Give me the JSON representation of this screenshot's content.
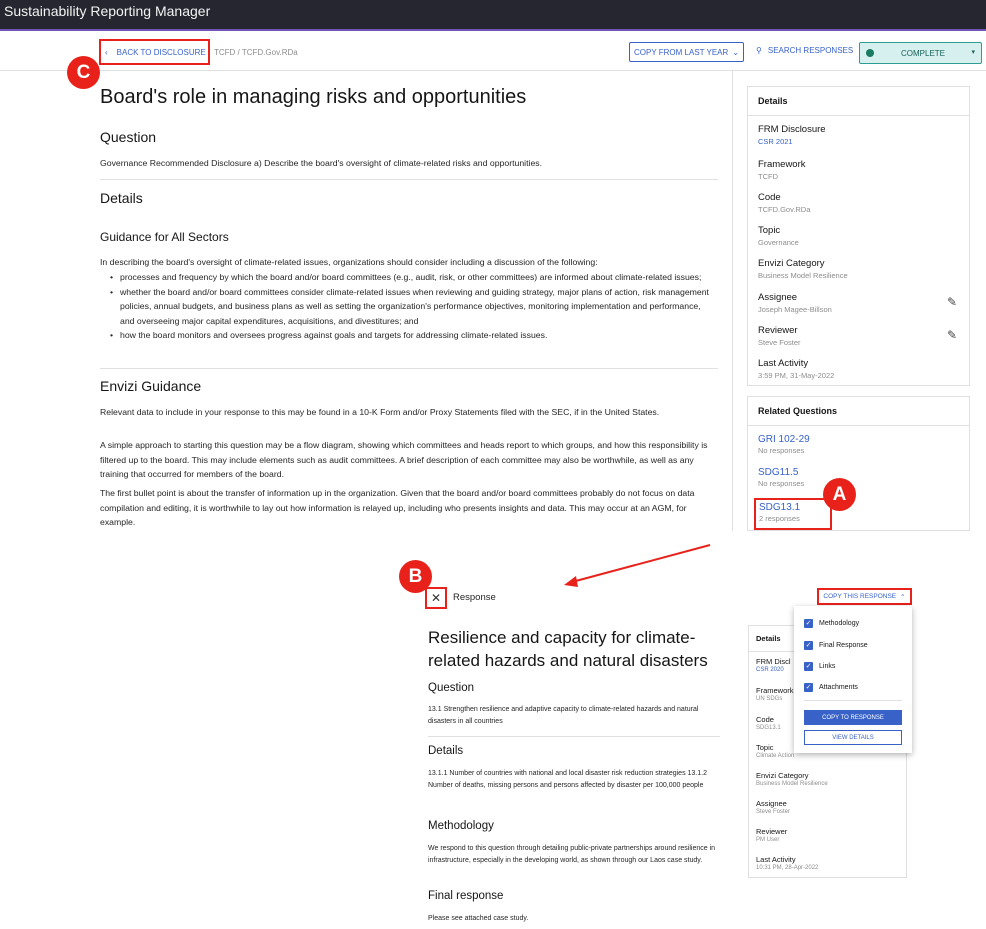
{
  "app": {
    "title": "Sustainability Reporting Manager"
  },
  "subbar": {
    "back_label": "BACK TO DISCLOSURE",
    "breadcrumb": "TCFD  /  TCFD.Gov.RDa",
    "copy_from_last_year": "COPY FROM LAST YEAR",
    "search_responses": "SEARCH RESPONSES",
    "status": "COMPLETE",
    "status_color": "#1a7a62"
  },
  "markers": {
    "a": "A",
    "b": "B",
    "c": "C"
  },
  "main": {
    "title": "Board's role in managing risks and opportunities",
    "question_heading": "Question",
    "question_text": "Governance Recommended Disclosure a) Describe the board's oversight of climate-related risks and opportunities.",
    "details_heading": "Details",
    "guidance_heading": "Guidance for All Sectors",
    "guidance_intro": "In describing the board's oversight of climate-related issues, organizations should consider including a discussion of the following:",
    "bullets": [
      "processes and frequency by which the board and/or board committees (e.g., audit, risk, or other committees) are informed about climate-related issues;",
      "whether the board and/or board committees consider climate-related issues when reviewing and guiding strategy, major plans of action, risk management policies, annual budgets, and business plans as well as setting the organization's performance objectives, monitoring implementation and performance, and overseeing major capital expenditures, acquisitions, and divestitures; and",
      "how the board monitors and oversees progress against goals and targets for addressing climate-related issues."
    ],
    "envizi_heading": "Envizi Guidance",
    "envizi_p1": "Relevant data to include in your response to this may be found in a 10-K Form and/or Proxy Statements filed with the SEC, if in the United States.",
    "envizi_p2": "A simple approach to starting this question may be a flow diagram, showing which committees and heads report to which groups, and how this responsibility is filtered up to the board. This may include elements such as audit committees. A brief description of each committee may also be worthwhile, as well as any training that occurred for members of the board.",
    "envizi_p3": "The first bullet point is about the transfer of information up in the organization. Given that the board and/or board committees probably do not focus on data compilation and editing, it is worthwhile to lay out how information is relayed up, including who presents insights and data. This may occur at an AGM, for example."
  },
  "details_card": {
    "title": "Details",
    "fields": [
      {
        "k": "FRM Disclosure",
        "v": "CSR 2021"
      },
      {
        "k": "Framework",
        "v": "TCFD"
      },
      {
        "k": "Code",
        "v": "TCFD.Gov.RDa"
      },
      {
        "k": "Topic",
        "v": "Governance"
      },
      {
        "k": "Envizi Category",
        "v": "Business Model Resilience"
      },
      {
        "k": "Assignee",
        "v": "Joseph Magee-Billson"
      },
      {
        "k": "Reviewer",
        "v": "Steve Foster"
      },
      {
        "k": "Last Activity",
        "v": "3:59 PM, 31-May-2022"
      }
    ]
  },
  "related": {
    "title": "Related Questions",
    "items": [
      {
        "k": "GRI 102-29",
        "v": "No responses"
      },
      {
        "k": "SDG11.5",
        "v": "No responses"
      },
      {
        "k": "SDG13.1",
        "v": "2 responses"
      }
    ]
  },
  "response": {
    "label": "Response",
    "copy_this": "COPY THIS RESPONSE",
    "title": "Resilience and capacity for climate-related hazards and natural disasters",
    "question_heading": "Question",
    "question_text": "13.1 Strengthen resilience and adaptive capacity to climate-related hazards and natural disasters in all countries",
    "details_heading": "Details",
    "details_text": "13.1.1 Number of countries with national and local disaster risk reduction strategies 13.1.2 Number of deaths, missing persons and persons affected by disaster per 100,000 people",
    "methodology_heading": "Methodology",
    "methodology_text": "We respond to this question through detailing public-private partnerships around resilience in infrastructure, especially in the developing world, as shown through our Laos case study.",
    "final_heading": "Final response",
    "final_text": "Please see attached case study."
  },
  "mini_card": {
    "title": "Details",
    "fields": [
      {
        "k": "FRM Discl",
        "v": "CSR 2020"
      },
      {
        "k": "Framework",
        "v": "UN SDGs"
      },
      {
        "k": "Code",
        "v": "SDG13.1"
      },
      {
        "k": "Topic",
        "v": "Climate Action"
      },
      {
        "k": "Envizi Category",
        "v": "Business Model Resilience"
      },
      {
        "k": "Assignee",
        "v": "Steve Foster"
      },
      {
        "k": "Reviewer",
        "v": "PM User"
      },
      {
        "k": "Last Activity",
        "v": "10:31 PM, 28-Apr-2022"
      }
    ]
  },
  "dropdown": {
    "options": [
      "Methodology",
      "Final Response",
      "Links",
      "Attachments"
    ],
    "primary": "COPY TO RESPONSE",
    "secondary": "VIEW DETAILS"
  }
}
